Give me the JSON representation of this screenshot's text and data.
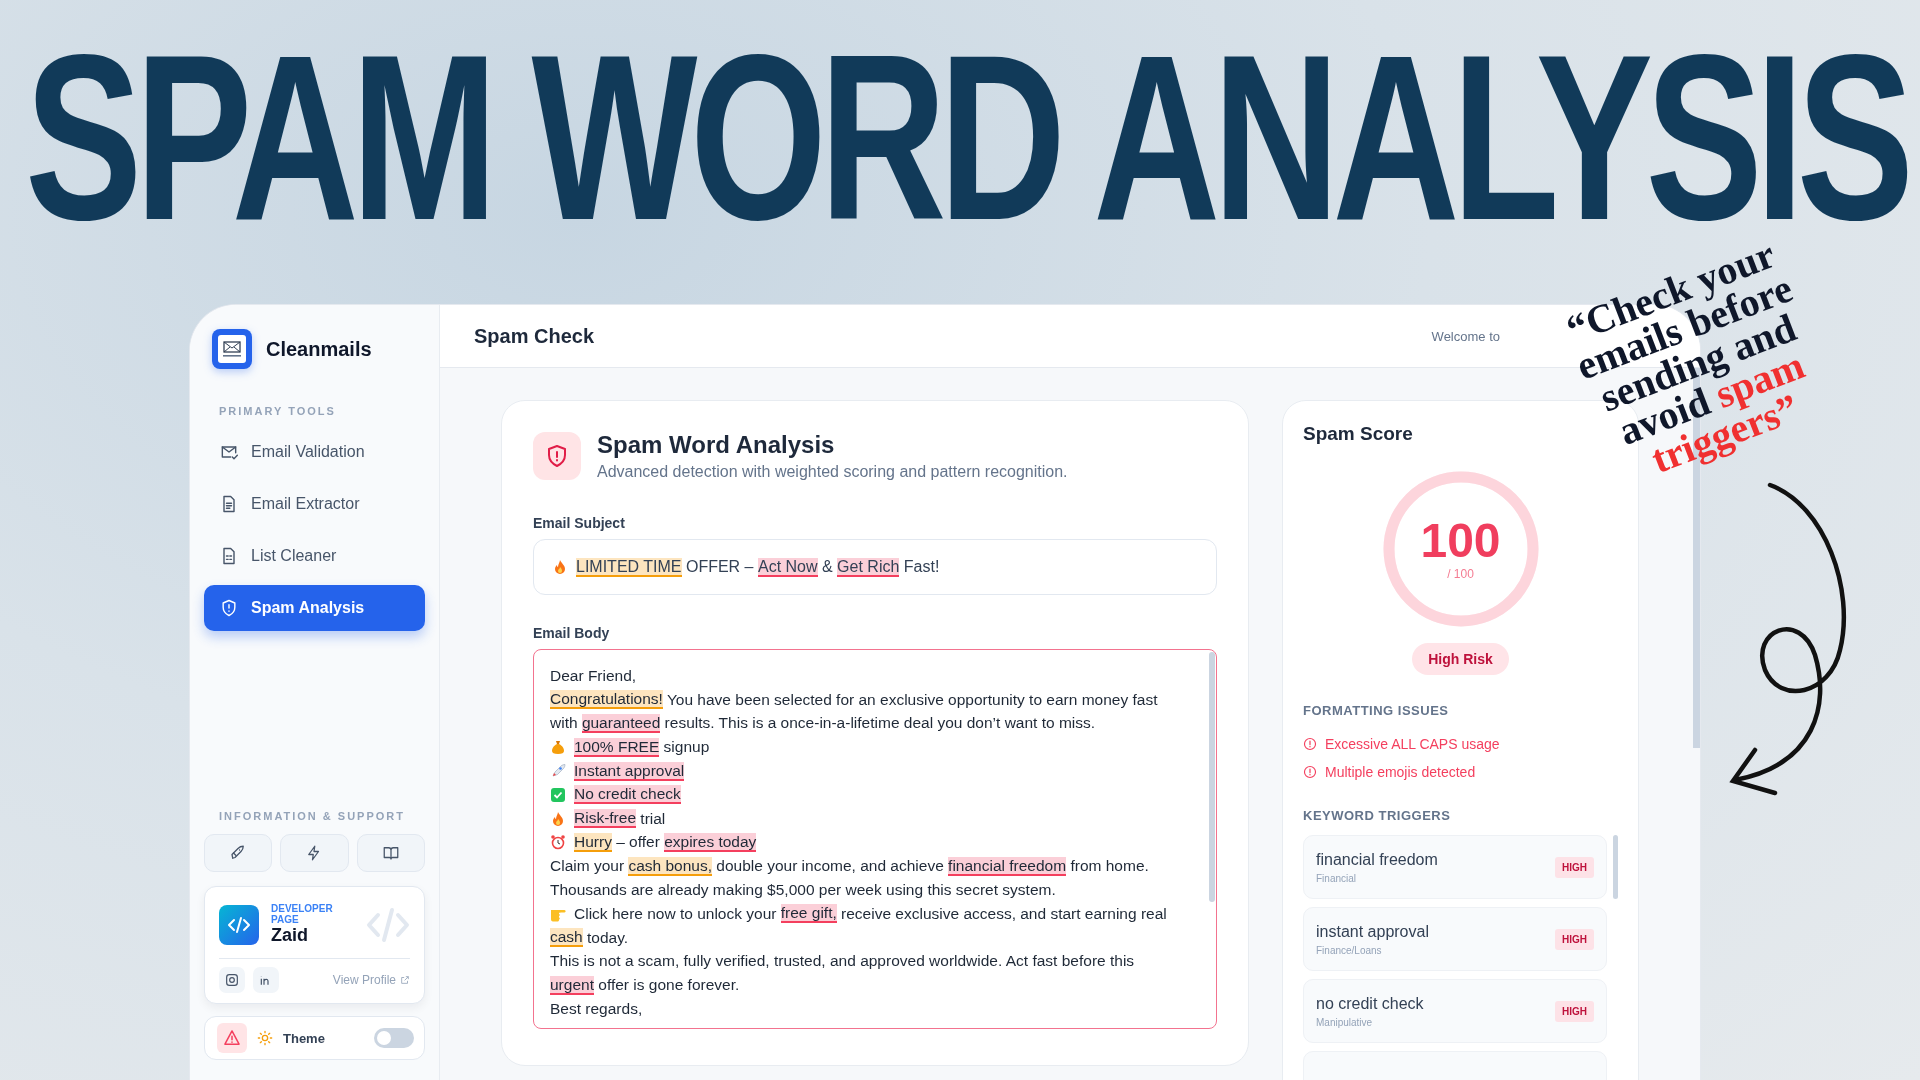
{
  "headline": "SPAM WORD ANALYSIS",
  "quote": {
    "lines": [
      [
        {
          "text": "“Check your",
          "accent": false
        }
      ],
      [
        {
          "text": "emails before",
          "accent": false
        }
      ],
      [
        {
          "text": "sending and",
          "accent": false
        }
      ],
      [
        {
          "text": "avoid ",
          "accent": false
        },
        {
          "text": "spam",
          "accent": true
        }
      ],
      [
        {
          "text": "triggers”",
          "accent": true
        }
      ]
    ]
  },
  "sidebar": {
    "brand": "Cleanmails",
    "primary_heading": "PRIMARY TOOLS",
    "items": [
      {
        "label": "Email Validation",
        "kind": "mail",
        "selected": false
      },
      {
        "label": "Email Extractor",
        "kind": "doc",
        "selected": false
      },
      {
        "label": "List Cleaner",
        "kind": "sheet",
        "selected": false
      },
      {
        "label": "Spam Analysis",
        "kind": "shield",
        "selected": true
      }
    ],
    "support_heading": "INFORMATION & SUPPORT",
    "support_buttons": [
      {
        "kind": "rocket"
      },
      {
        "kind": "bolt"
      },
      {
        "kind": "book"
      }
    ],
    "developer": {
      "label": "DEVELOPER PAGE",
      "name": "Zaid",
      "link": "View Profile"
    },
    "theme": {
      "label": "Theme",
      "on": false
    }
  },
  "header": {
    "title": "Spam Check",
    "welcome": "Welcome to"
  },
  "analysis": {
    "title": "Spam Word Analysis",
    "subtitle": "Advanced detection with weighted scoring and pattern recognition.",
    "subject_label": "Email Subject",
    "subject": {
      "kind": "flame",
      "segments": [
        {
          "text": "LIMITED TIME",
          "kind": "warning"
        },
        {
          "text": " OFFER – ",
          "kind": "plain"
        },
        {
          "text": "Act Now",
          "kind": "danger"
        },
        {
          "text": " & ",
          "kind": "plain"
        },
        {
          "text": "Get Rich",
          "kind": "danger"
        },
        {
          "text": " Fast!",
          "kind": "plain"
        }
      ]
    },
    "body_label": "Email Body",
    "body": [
      {
        "kind": "text",
        "segments": [
          {
            "text": "Dear Friend,",
            "kind": "plain"
          }
        ]
      },
      {
        "kind": "text",
        "segments": [
          {
            "text": "Congratulations!",
            "kind": "warning"
          },
          {
            "text": " You have been selected for an exclusive opportunity to earn money fast",
            "kind": "plain"
          }
        ]
      },
      {
        "kind": "text",
        "segments": [
          {
            "text": "with ",
            "kind": "plain"
          },
          {
            "text": "guaranteed",
            "kind": "danger"
          },
          {
            "text": " results. This is a once-in-a-lifetime deal you don’t want to miss.",
            "kind": "plain"
          }
        ]
      },
      {
        "kind": "moneybag",
        "segments": [
          {
            "text": "100% FREE",
            "kind": "danger"
          },
          {
            "text": " signup",
            "kind": "plain"
          }
        ]
      },
      {
        "kind": "rocket",
        "segments": [
          {
            "text": "Instant approval",
            "kind": "danger"
          }
        ]
      },
      {
        "kind": "check",
        "segments": [
          {
            "text": "No credit check",
            "kind": "danger"
          }
        ]
      },
      {
        "kind": "flame",
        "segments": [
          {
            "text": "Risk-free",
            "kind": "danger"
          },
          {
            "text": " trial",
            "kind": "plain"
          }
        ]
      },
      {
        "kind": "alarm",
        "segments": [
          {
            "text": "Hurry",
            "kind": "warning"
          },
          {
            "text": " – offer ",
            "kind": "plain"
          },
          {
            "text": "expires today",
            "kind": "danger"
          }
        ]
      },
      {
        "kind": "text",
        "segments": [
          {
            "text": "Claim your ",
            "kind": "plain"
          },
          {
            "text": "cash bonus,",
            "kind": "warning"
          },
          {
            "text": " double your income, and achieve ",
            "kind": "plain"
          },
          {
            "text": "financial freedom",
            "kind": "danger"
          },
          {
            "text": " from home.",
            "kind": "plain"
          }
        ]
      },
      {
        "kind": "text",
        "segments": [
          {
            "text": "Thousands are already making $5,000 per week using this secret system.",
            "kind": "plain"
          }
        ]
      },
      {
        "kind": "hand",
        "segments": [
          {
            "text": "Click here now to unlock your ",
            "kind": "plain"
          },
          {
            "text": "free gift,",
            "kind": "danger"
          },
          {
            "text": " receive exclusive access, and start earning real",
            "kind": "plain"
          }
        ]
      },
      {
        "kind": "text",
        "segments": [
          {
            "text": "cash",
            "kind": "warning"
          },
          {
            "text": " today.",
            "kind": "plain"
          }
        ]
      },
      {
        "kind": "text",
        "segments": [
          {
            "text": "This is not a scam, fully verified, trusted, and approved worldwide. Act fast before this",
            "kind": "plain"
          }
        ]
      },
      {
        "kind": "text",
        "segments": [
          {
            "text": "urgent",
            "kind": "danger"
          },
          {
            "text": " offer is gone forever.",
            "kind": "plain"
          }
        ]
      },
      {
        "kind": "text",
        "segments": [
          {
            "text": "Best regards,",
            "kind": "plain"
          }
        ]
      }
    ]
  },
  "score": {
    "title": "Spam Score",
    "value": "100",
    "max": "/ 100",
    "level": 1,
    "risk": "High Risk",
    "formatting_heading": "FORMATTING ISSUES",
    "formatting_issues": [
      "Excessive ALL CAPS usage",
      "Multiple emojis detected"
    ],
    "keyword_heading": "KEYWORD TRIGGERS",
    "triggers": [
      {
        "keyword": "financial freedom",
        "category": "Financial",
        "severity": "HIGH"
      },
      {
        "keyword": "instant approval",
        "category": "Finance/Loans",
        "severity": "HIGH"
      },
      {
        "keyword": "no credit check",
        "category": "Manipulative",
        "severity": "HIGH"
      }
    ]
  }
}
